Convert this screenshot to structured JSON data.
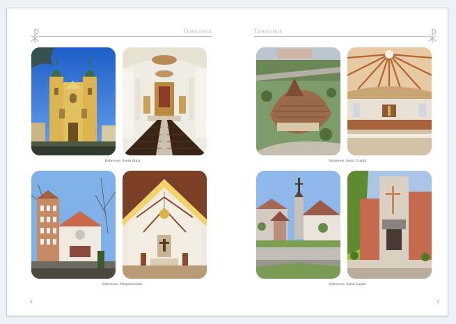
{
  "spread": {
    "left_page": {
      "header_title": "Templomok",
      "page_number": "2",
      "captions": [
        "Debrecen, Szent Anna",
        "Debrecen, Megtestesülés"
      ]
    },
    "right_page": {
      "header_title": "Templomok",
      "page_number": "3",
      "captions": [
        "Debrecen, Szent Család",
        "Debrecen, Szent László"
      ]
    }
  }
}
